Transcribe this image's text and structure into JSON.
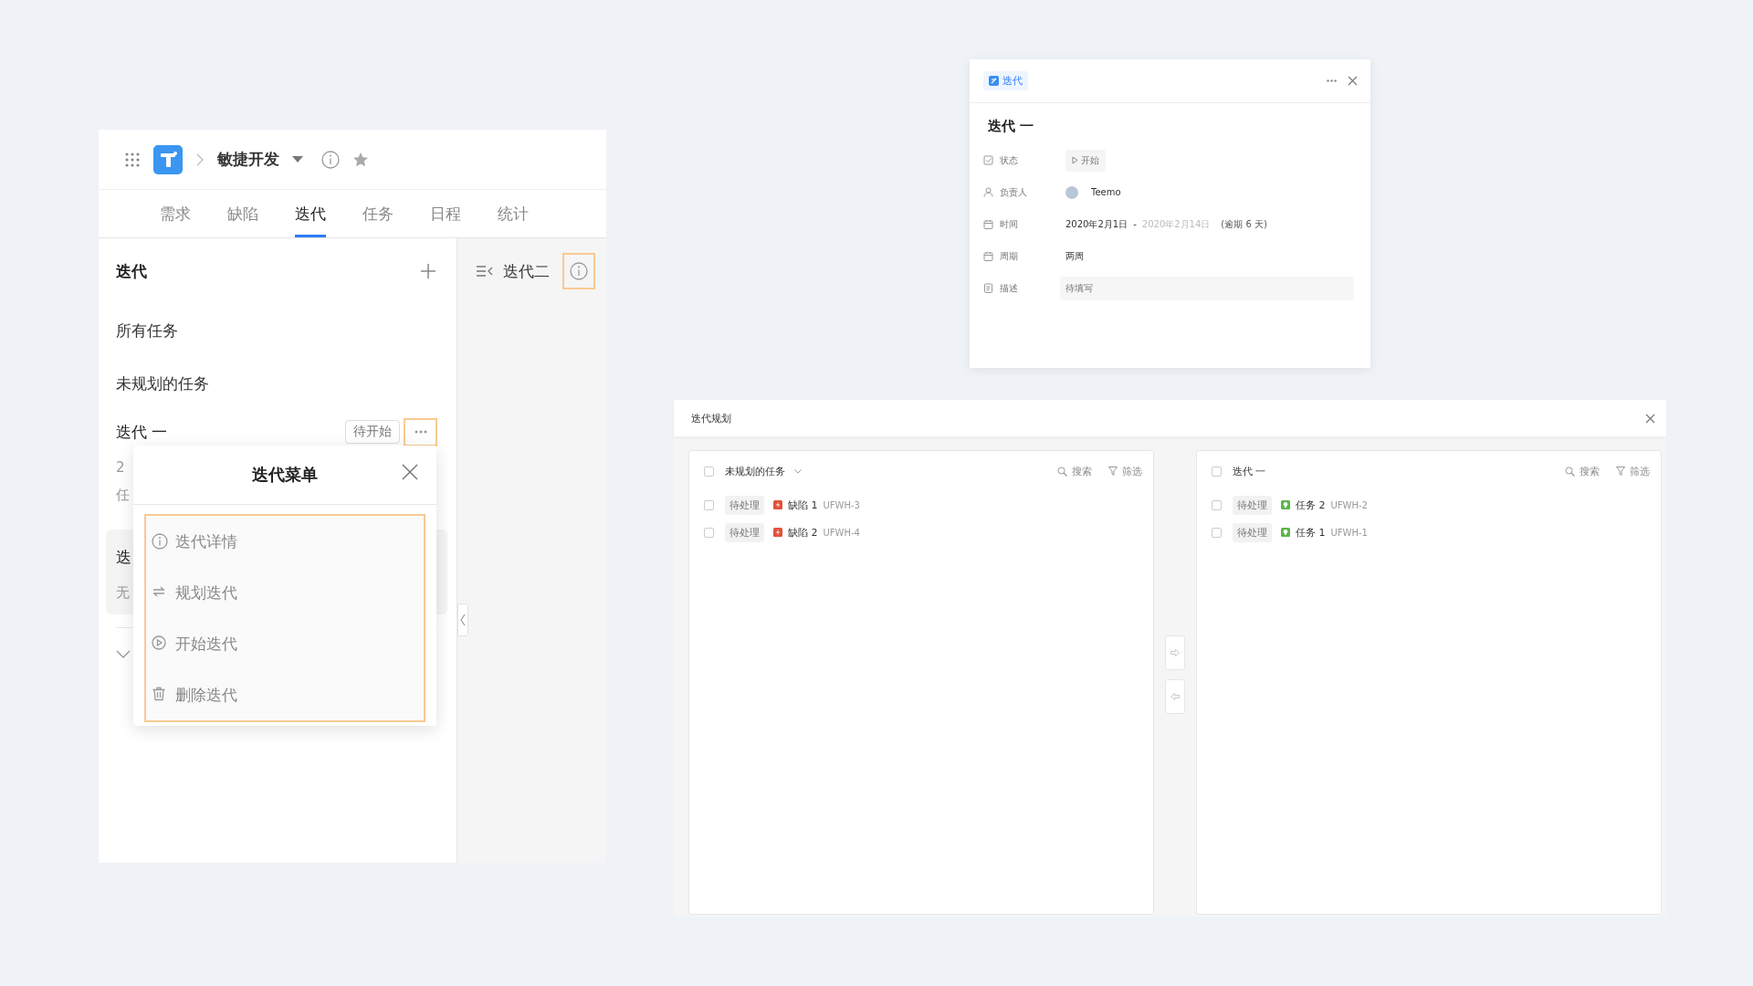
{
  "app_panel": {
    "project": "敏捷开发",
    "tabs": [
      {
        "label": "需求",
        "selected": false
      },
      {
        "label": "缺陷",
        "selected": false
      },
      {
        "label": "迭代",
        "selected": true
      },
      {
        "label": "任务",
        "selected": false
      },
      {
        "label": "日程",
        "selected": false
      },
      {
        "label": "统计",
        "selected": false
      }
    ],
    "sidebar": {
      "title": "迭代",
      "links": [
        "所有任务",
        "未规划的任务"
      ],
      "iterations": [
        {
          "title": "迭代 一",
          "status": "待开始",
          "more_highlighted": true,
          "lines": [
            "2",
            "任"
          ],
          "selected": false
        },
        {
          "title": "迭",
          "lines": [
            "无"
          ],
          "selected": true
        }
      ]
    },
    "content": {
      "title": "迭代二",
      "info_highlighted": true
    },
    "menu": {
      "title": "迭代菜单",
      "highlighted": true,
      "items": [
        {
          "kind": "info",
          "label": "迭代详情"
        },
        {
          "kind": "plan",
          "label": "规划迭代"
        },
        {
          "kind": "start",
          "label": "开始迭代"
        },
        {
          "kind": "delete",
          "label": "删除迭代"
        }
      ]
    }
  },
  "detail_dialog": {
    "tag": "迭代",
    "title": "迭代 一",
    "fields": [
      {
        "kind": "status",
        "label": "状态",
        "value": "开始"
      },
      {
        "kind": "owner",
        "label": "负责人",
        "value": "Teemo"
      },
      {
        "kind": "time",
        "label": "时间",
        "start": "2020年2月1日",
        "separator": "-",
        "end": "2020年2月14日",
        "note": "(逾期 6 天)"
      },
      {
        "kind": "cycle",
        "label": "周期",
        "value": "两周"
      },
      {
        "kind": "description",
        "label": "描述",
        "placeholder": "待填写"
      }
    ]
  },
  "planning_dialog": {
    "title": "迭代规划",
    "lists": [
      {
        "title": "未规划的任务",
        "checked": false,
        "dropdown": true,
        "search": "搜索",
        "filter": "筛选",
        "rows": [
          {
            "checked": false,
            "status": "待处理",
            "kind": "bug",
            "title": "缺陷 1",
            "key": "UFWH-3"
          },
          {
            "checked": false,
            "status": "待处理",
            "kind": "bug",
            "title": "缺陷 2",
            "key": "UFWH-4"
          }
        ]
      },
      {
        "title": "迭代 一",
        "checked": false,
        "dropdown": false,
        "search": "搜索",
        "filter": "筛选",
        "rows": [
          {
            "checked": false,
            "status": "待处理",
            "kind": "task",
            "title": "任务 2",
            "key": "UFWH-2"
          },
          {
            "checked": false,
            "status": "待处理",
            "kind": "task",
            "title": "任务 1",
            "key": "UFWH-1"
          }
        ]
      }
    ]
  }
}
